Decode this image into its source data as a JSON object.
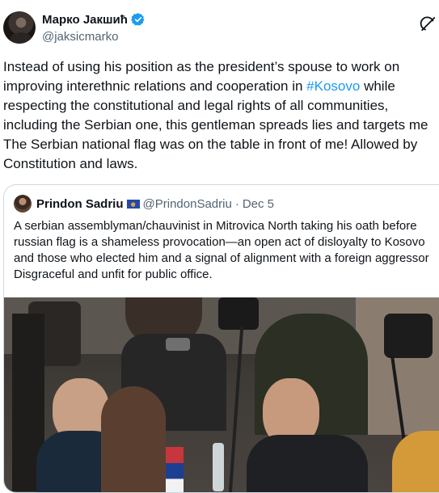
{
  "tweet": {
    "author": {
      "name": "Марко Јакшић",
      "handle": "@jaksicmarko",
      "verified": true
    },
    "text_lines": [
      {
        "before": "Instead of using his position as the president’s spouse to work on",
        "hashtag": "",
        "after": ""
      },
      {
        "before": "improving interethnic relations and cooperation in ",
        "hashtag": "#Kosovo",
        "after": " while"
      },
      {
        "before": "respecting the constitutional and legal rights of all communities,",
        "hashtag": "",
        "after": ""
      },
      {
        "before": "including the Serbian one, this gentleman spreads lies and targets me",
        "hashtag": "",
        "after": ""
      },
      {
        "before": "The Serbian national flag was on the table in front of me! Allowed by",
        "hashtag": "",
        "after": ""
      },
      {
        "before": "Constitution and laws.",
        "hashtag": "",
        "after": ""
      }
    ]
  },
  "quoted_tweet": {
    "author": {
      "name": "Prindon Sadriu",
      "handle": "@PrindonSadriu",
      "date": "Dec 5",
      "separator": "·"
    },
    "text_lines": [
      "A serbian assemblyman/chauvinist in Mitrovica  North taking his oath before",
      "russian flag is a shameless provocation—an open act of disloyalty to Kosovo",
      "and those who elected him and a signal of alignment with a foreign aggressor",
      "Disgraceful and unfit for public office."
    ]
  },
  "icons": {
    "verified": "verified-badge-icon",
    "grok": "grok-icon",
    "flag": "kosovo-flag-icon"
  },
  "colors": {
    "text": "#0f1419",
    "secondary": "#536471",
    "link": "#1d9bf0",
    "border": "#cfd9de"
  }
}
